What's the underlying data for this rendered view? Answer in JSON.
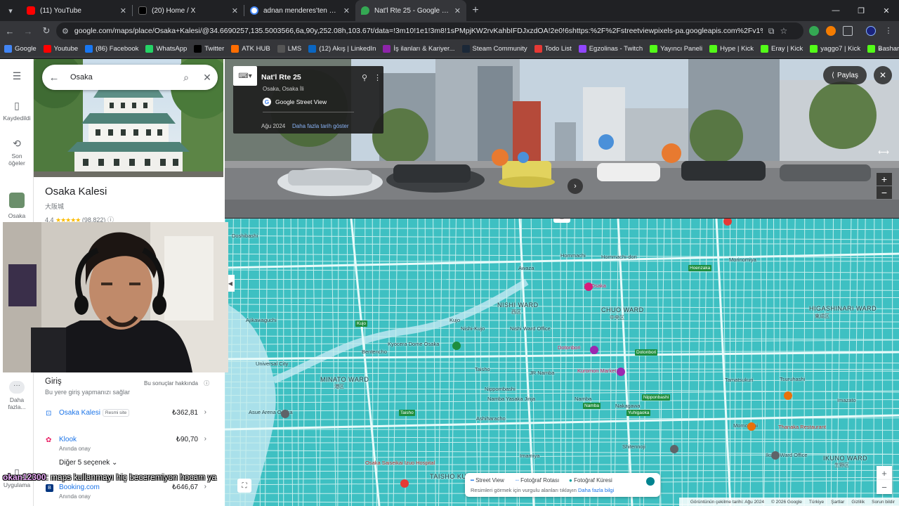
{
  "browser": {
    "tabs": [
      {
        "title": "(11) YouTube",
        "fav_color": "#ff0000",
        "active": false
      },
      {
        "title": "(20) Home / X",
        "fav_color": "#000000",
        "active": false
      },
      {
        "title": "adnan menderes'ten sonraki cu",
        "fav_color": "#4285f4",
        "active": false
      },
      {
        "title": "Nat'l Rte 25 - Google Haritalar",
        "fav_color": "#34a853",
        "active": true
      }
    ],
    "url": "google.com/maps/place/Osaka+Kalesi/@34.6690257,135.5003566,6a,90y,252.08h,103.67t/data=!3m10!1e1!3m8!1sPMpjKW2rvKahbIFDJxzdOA!2e0!6shttps:%2F%2Fstreetviewpixels-pa.googleapis.com%2Fv1%2Fthumbnail%3Fcb_client%3...",
    "bookmarks": [
      {
        "label": "Google",
        "icon": "google-icon",
        "color": "#4285f4"
      },
      {
        "label": "Youtube",
        "icon": "youtube-icon",
        "color": "#ff0000"
      },
      {
        "label": "(86) Facebook",
        "icon": "facebook-icon",
        "color": "#1877f2"
      },
      {
        "label": "WhatsApp",
        "icon": "whatsapp-icon",
        "color": "#25d366"
      },
      {
        "label": "Twitter",
        "icon": "x-icon",
        "color": "#000000"
      },
      {
        "label": "ATK HUB",
        "icon": "atk-icon",
        "color": "#ff6d00"
      },
      {
        "label": "LMS",
        "icon": "lms-icon",
        "color": "#555555"
      },
      {
        "label": "(12) Akış | LinkedIn",
        "icon": "linkedin-icon",
        "color": "#0a66c2"
      },
      {
        "label": "İş ilanları & Kariyer...",
        "icon": "kariyer-icon",
        "color": "#8e24aa"
      },
      {
        "label": "Steam Community",
        "icon": "steam-icon",
        "color": "#1b2838"
      },
      {
        "label": "Todo List",
        "icon": "todo-icon",
        "color": "#e53935"
      },
      {
        "label": "Egzolinas - Twitch",
        "icon": "twitch-icon",
        "color": "#9146ff"
      },
      {
        "label": "Yayıncı Paneli",
        "icon": "kick-icon",
        "color": "#53fc18"
      },
      {
        "label": "Hype | Kick",
        "icon": "kick-icon",
        "color": "#53fc18"
      },
      {
        "label": "Eray | Kick",
        "icon": "kick-icon",
        "color": "#53fc18"
      },
      {
        "label": "yaggo7 | Kick",
        "icon": "kick-icon",
        "color": "#53fc18"
      },
      {
        "label": "Bashars | Kick",
        "icon": "kick-icon",
        "color": "#53fc18"
      },
      {
        "label": "dirim | Kick",
        "icon": "kick-icon",
        "color": "#53fc18"
      }
    ]
  },
  "rail": {
    "saved": "Kaydedildi",
    "recent_1": "Son",
    "recent_2": "öğeler",
    "osaka": "Osaka",
    "more_1": "Daha",
    "more_2": "fazla...",
    "apps": "Uygulama"
  },
  "search": {
    "value": "Osaka"
  },
  "place": {
    "name": "Osaka Kalesi",
    "name_jp": "大阪城",
    "rating": "4,4",
    "stars": "★★★★★",
    "reviews": "(98.822)"
  },
  "booking": {
    "title": "Giriş",
    "subtitle": "Bu yere giriş yapmanızı sağlar",
    "about": "Bu sonuçlar hakkında",
    "offers": [
      {
        "name": "Osaka Kalesi",
        "badge": "Resmi site",
        "price": "₺362,81",
        "sub": ""
      },
      {
        "name": "Klook",
        "badge": "",
        "price": "₺90,70",
        "sub": "Anında onay"
      },
      {
        "name": "Booking.com",
        "badge": "",
        "price": "₺646,67",
        "sub": "Anında onay"
      }
    ],
    "more": "Diğer 5 seçenek"
  },
  "streetview": {
    "title": "Nat'l Rte 25",
    "subtitle": "Osaka, Osaka İli",
    "brand": "Google Street View",
    "date": "Ağu 2024",
    "history": "Daha fazla tarih göster",
    "share": "Paylaş"
  },
  "map": {
    "labels": [
      {
        "t": "Hommachi",
        "c": ""
      },
      {
        "t": "Hommachi-dori",
        "c": ""
      },
      {
        "t": "Awaza",
        "c": ""
      },
      {
        "t": "Morinomiya",
        "c": ""
      },
      {
        "t": "W Osaka",
        "c": "pink"
      },
      {
        "t": "NISHI WARD",
        "c": "ward"
      },
      {
        "t": "西区",
        "c": "jp"
      },
      {
        "t": "CHUO WARD",
        "c": "ward"
      },
      {
        "t": "中央区",
        "c": "jp"
      },
      {
        "t": "Kujo",
        "c": ""
      },
      {
        "t": "Ajikawaguchi",
        "c": ""
      },
      {
        "t": "Bentencho",
        "c": ""
      },
      {
        "t": "Kyocera Dome Osaka",
        "c": ""
      },
      {
        "t": "Dotonbori",
        "c": "pink"
      },
      {
        "t": "Kuromon Market",
        "c": "pink"
      },
      {
        "t": "MINATO WARD",
        "c": "ward"
      },
      {
        "t": "港区",
        "c": "jp"
      },
      {
        "t": "Osaka Saiseikai Izuo Hospital",
        "c": "red"
      },
      {
        "t": "TAISHO KU",
        "c": "ward"
      },
      {
        "t": "Namba",
        "c": ""
      },
      {
        "t": "Nippombashi",
        "c": ""
      },
      {
        "t": "Ashiharacho",
        "c": ""
      },
      {
        "t": "Imamiya",
        "c": ""
      },
      {
        "t": "HIGASHINARI WARD",
        "c": "ward"
      },
      {
        "t": "東成区",
        "c": "jp"
      },
      {
        "t": "Tsuruhashi",
        "c": ""
      },
      {
        "t": "Tamatsukuri",
        "c": ""
      },
      {
        "t": "Momodani",
        "c": ""
      },
      {
        "t": "Thanaka Restaurant",
        "c": "red"
      },
      {
        "t": "IKUNO WARD",
        "c": "ward"
      },
      {
        "t": "生野区",
        "c": "jp"
      },
      {
        "t": "Ikuno Ward Office",
        "c": ""
      },
      {
        "t": "Shitennoji",
        "c": ""
      },
      {
        "t": "Taisho",
        "c": ""
      },
      {
        "t": "Asue Arena Osaka",
        "c": ""
      },
      {
        "t": "Namba Yasaka Jinja",
        "c": ""
      },
      {
        "t": "Universal City",
        "c": ""
      },
      {
        "t": "Nishi Ward Office",
        "c": ""
      },
      {
        "t": "Nishi-Kujo",
        "c": ""
      },
      {
        "t": "Doshibashi",
        "c": ""
      },
      {
        "t": "JR Namba",
        "c": ""
      },
      {
        "t": "Nakagawa",
        "c": ""
      },
      {
        "t": "Imazato",
        "c": ""
      }
    ],
    "stations": [
      "Hoenzaka",
      "Namba",
      "Dotonbori",
      "Nipponbashi",
      "Yuhigaoka",
      "Taisho",
      "Kujo"
    ],
    "legend": {
      "street_view": "Street View",
      "photo_route": "Fotoğraf Rotası",
      "photo_sphere": "Fotoğraf Küresi",
      "hint": "Resimleri görmek için vurgulu alanları tıklayın",
      "more": "Daha fazla bilgi"
    },
    "footer": [
      "Görüntünün çekilme tarihi: Ağu 2024",
      "© 2026 Google",
      "Türkiye",
      "Şartlar",
      "Gizlilik",
      "Sorun bildir"
    ]
  },
  "chat": {
    "user": "okan12300",
    "message": ": maps kullanmayı hiç beceremiyon hocam ya"
  },
  "colors": {
    "chrome_dark": "#202124",
    "chrome_toolbar": "#35363a",
    "map_teal": "#3ec0c2",
    "link_blue": "#1a73e8"
  }
}
